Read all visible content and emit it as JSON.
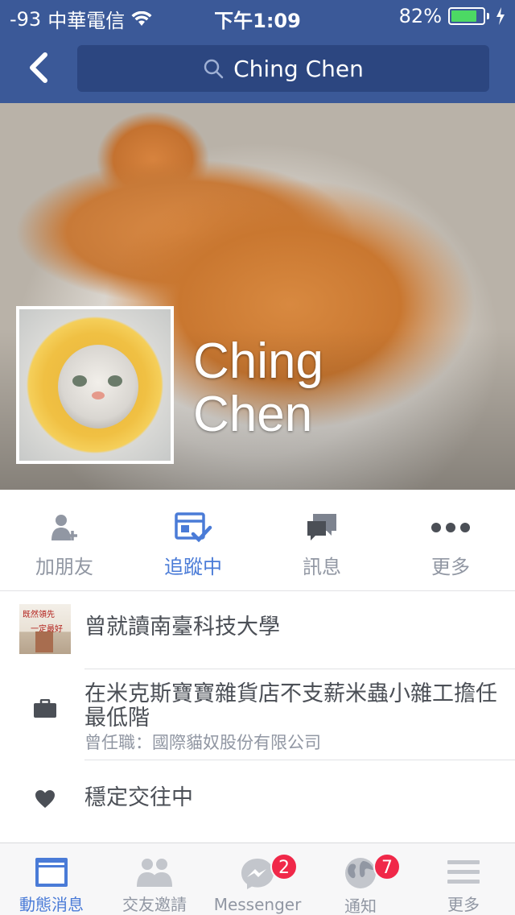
{
  "status_bar": {
    "signal": "-93",
    "carrier": "中華電信",
    "time": "下午1:09",
    "battery_percent": "82%",
    "battery_level": 0.82
  },
  "nav": {
    "search_text": "Ching Chen"
  },
  "profile": {
    "name_line1": "Ching",
    "name_line2": "Chen"
  },
  "actions": [
    {
      "label": "加朋友",
      "icon": "add-friend-icon"
    },
    {
      "label": "追蹤中",
      "icon": "following-icon"
    },
    {
      "label": "訊息",
      "icon": "message-icon"
    },
    {
      "label": "更多",
      "icon": "more-icon"
    }
  ],
  "about": {
    "education": {
      "label": "曾就讀南臺科技大學",
      "thumb_line1": "既然領先",
      "thumb_line2": "一定最好"
    },
    "work": {
      "title": "在米克斯寶寶雜貨店不支薪米蟲小雜工擔任最低階",
      "subtitle": "曾任職：國際貓奴股份有限公司"
    },
    "relationship": {
      "label": "穩定交往中"
    }
  },
  "tabbar": [
    {
      "label": "動態消息",
      "icon": "news-feed-icon",
      "active": true
    },
    {
      "label": "交友邀請",
      "icon": "friend-requests-icon"
    },
    {
      "label": "Messenger",
      "icon": "messenger-icon",
      "badge": "2"
    },
    {
      "label": "通知",
      "icon": "globe-icon",
      "badge": "7"
    },
    {
      "label": "更多",
      "icon": "menu-icon"
    }
  ],
  "colors": {
    "brand": "#3b5998",
    "active": "#4a7bd7",
    "badge": "#f02849",
    "battery": "#4cd964"
  }
}
